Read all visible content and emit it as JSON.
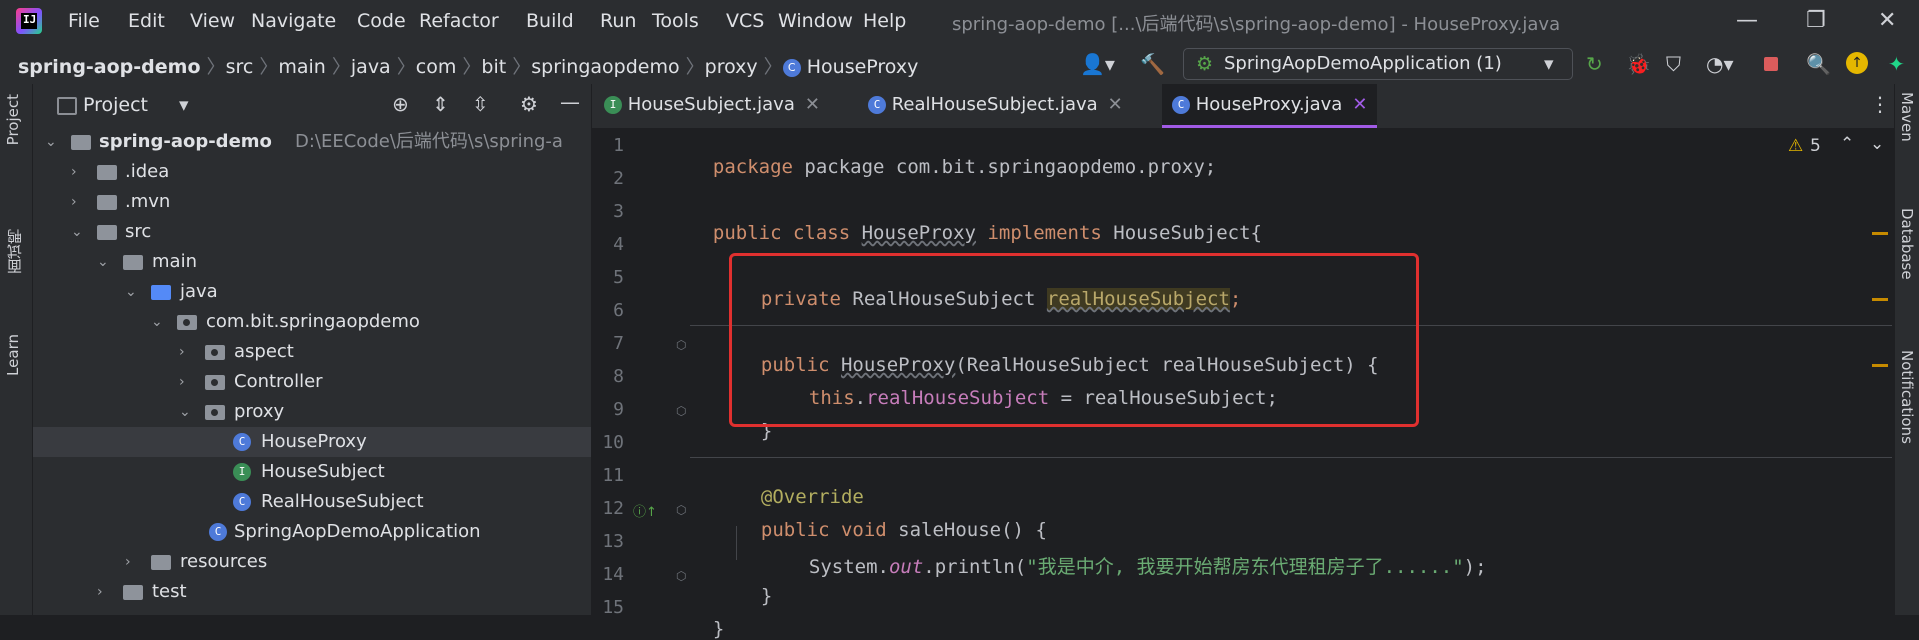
{
  "menu": [
    "File",
    "Edit",
    "View",
    "Navigate",
    "Code",
    "Refactor",
    "Build",
    "Run",
    "Tools",
    "VCS",
    "Window",
    "Help"
  ],
  "window_title": "spring-aop-demo [...\\后端代码\\s\\spring-aop-demo] - HouseProxy.java",
  "breadcrumb": [
    "spring-aop-demo",
    "src",
    "main",
    "java",
    "com",
    "bit",
    "springaopdemo",
    "proxy",
    "HouseProxy"
  ],
  "run_config": "SpringAopDemoApplication (1)",
  "left_strip": [
    "Project",
    "面试鸭",
    "Learn"
  ],
  "right_strip": [
    "Maven",
    "Database",
    "Notifications"
  ],
  "project": {
    "title": "Project",
    "root_name": "spring-aop-demo",
    "root_path": "D:\\EECode\\后端代码\\s\\spring-a",
    "items": [
      {
        "label": ".idea"
      },
      {
        "label": ".mvn"
      },
      {
        "label": "src"
      },
      {
        "label": "main"
      },
      {
        "label": "java"
      },
      {
        "label": "com.bit.springaopdemo"
      },
      {
        "label": "aspect"
      },
      {
        "label": "Controller"
      },
      {
        "label": "proxy"
      },
      {
        "label": "HouseProxy"
      },
      {
        "label": "HouseSubject"
      },
      {
        "label": "RealHouseSubject"
      },
      {
        "label": "SpringAopDemoApplication"
      },
      {
        "label": "resources"
      },
      {
        "label": "test"
      }
    ]
  },
  "tabs": [
    {
      "label": "HouseSubject.java"
    },
    {
      "label": "RealHouseSubject.java"
    },
    {
      "label": "HouseProxy.java"
    }
  ],
  "editor": {
    "warnings": "5",
    "line_numbers": [
      "1",
      "2",
      "3",
      "4",
      "5",
      "6",
      "7",
      "8",
      "9",
      "10",
      "11",
      "12",
      "13",
      "14",
      "15"
    ],
    "lines": {
      "l1": "package com.bit.springaopdemo.proxy;",
      "l3_kw": "public class ",
      "l3_name": "HouseProxy",
      "l3_impl": " implements ",
      "l3_rest": "HouseSubject{",
      "l5_kw": "private ",
      "l5_type": "RealHouseSubject ",
      "l5_field": "realHouseSubject",
      "l5_end": ";",
      "l7_kw": "public ",
      "l7_name": "HouseProxy",
      "l7_rest": "(RealHouseSubject realHouseSubject) {",
      "l8_this": "this",
      "l8_dot": ".",
      "l8_field": "realHouseSubject",
      "l8_rest": " = realHouseSubject;",
      "l9": "}",
      "l11": "@Override",
      "l12_kw": "public void ",
      "l12_rest": "saleHouse() {",
      "l13_a": "System.",
      "l13_out": "out",
      "l13_b": ".println(",
      "l13_str": "\"我是中介, 我要开始帮房东代理租房子了......\"",
      "l13_c": ");",
      "l14": "}",
      "l15": "}"
    }
  }
}
